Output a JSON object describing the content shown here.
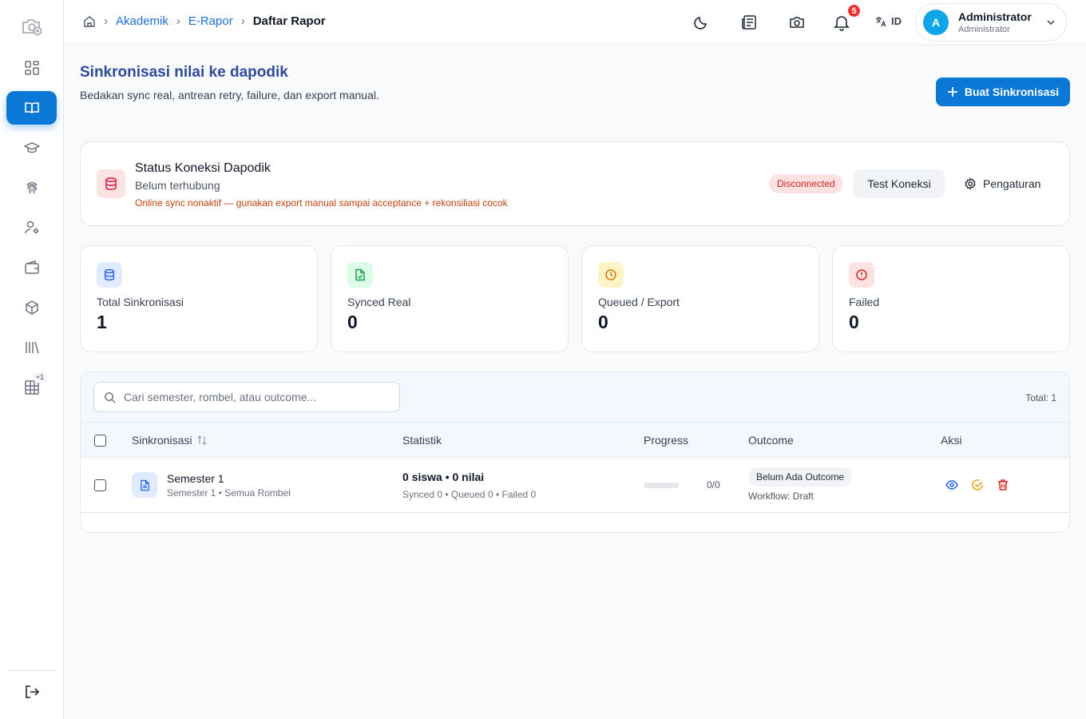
{
  "header": {
    "breadcrumb": [
      "Akademik",
      "E-Rapor",
      "Daftar Rapor"
    ],
    "notification_count": "5",
    "language": "ID",
    "user": {
      "initial": "A",
      "name": "Administrator",
      "role": "Administrator"
    }
  },
  "sidebar": {
    "items": [
      {
        "icon": "dashboard-icon"
      },
      {
        "icon": "book-icon",
        "active": true
      },
      {
        "icon": "graduation-cap-icon"
      },
      {
        "icon": "fingerprint-icon"
      },
      {
        "icon": "user-settings-icon"
      },
      {
        "icon": "wallet-icon"
      },
      {
        "icon": "package-icon"
      },
      {
        "icon": "library-icon"
      },
      {
        "icon": "grid-table-icon",
        "badge": "+1"
      }
    ],
    "logout_icon": "logout-icon"
  },
  "page": {
    "title": "Sinkronisasi nilai ke dapodik",
    "subtitle": "Bedakan sync real, antrean retry, failure, dan export manual.",
    "primary_button": "Buat Sinkronisasi"
  },
  "connection": {
    "title": "Status Koneksi Dapodik",
    "subtitle": "Belum terhubung",
    "warning": "Online sync nonaktif — gunakan export manual sampai acceptance + rekonsiliasi cocok",
    "status_badge": "Disconnected",
    "test_button": "Test Koneksi",
    "settings_button": "Pengaturan"
  },
  "stats": [
    {
      "label": "Total Sinkronisasi",
      "value": "1",
      "icon": "database-icon",
      "color": "#2563eb",
      "bg": "#e0ebff"
    },
    {
      "label": "Synced Real",
      "value": "0",
      "icon": "file-check-icon",
      "color": "#16a34a",
      "bg": "#dcfce7"
    },
    {
      "label": "Queued / Export",
      "value": "0",
      "icon": "clock-icon",
      "color": "#d97706",
      "bg": "#fef3c7"
    },
    {
      "label": "Failed",
      "value": "0",
      "icon": "alert-circle-icon",
      "color": "#dc2626",
      "bg": "#fde2e2"
    }
  ],
  "table": {
    "search_placeholder": "Cari semester, rombel, atau outcome...",
    "total": "Total: 1",
    "columns": [
      "Sinkronisasi",
      "Statistik",
      "Progress",
      "Outcome",
      "Aksi"
    ],
    "rows": [
      {
        "title": "Semester 1",
        "subtitle": "Semester 1 • Semua Rombel",
        "stat_main": "0 siswa • 0 nilai",
        "stat_sub": "Synced 0 • Queued 0 • Failed 0",
        "progress": 0,
        "progress_text": "0/0",
        "outcome": "Belum Ada Outcome",
        "workflow": "Workflow: Draft"
      }
    ]
  }
}
